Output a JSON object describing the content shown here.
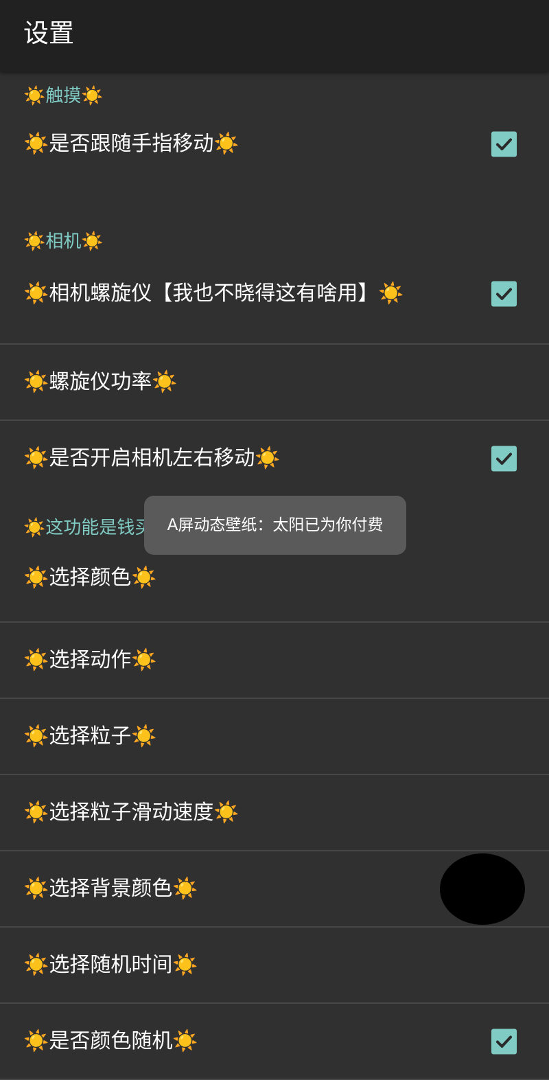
{
  "app_bar": {
    "title": "设置"
  },
  "preferences": {
    "touch_category": "☀️触摸☀️",
    "follow_finger": {
      "title": "☀️是否跟随手指移动☀️",
      "checked": true
    },
    "camera_category": "☀️相机☀️",
    "camera_gyro": {
      "title": "☀️相机螺旋仪【我也不晓得这有啥用】☀️",
      "checked": true
    },
    "gyro_power": {
      "title": "☀️螺旋仪功率☀️"
    },
    "camera_lr_move": {
      "title": "☀️是否开启相机左右移动☀️",
      "checked": true
    },
    "paid_category": "☀️这功能是钱买的☀️",
    "select_color": {
      "title": "☀️选择颜色☀️"
    },
    "select_action": {
      "title": "☀️选择动作☀️"
    },
    "select_particle": {
      "title": "☀️选择粒子☀️"
    },
    "particle_speed": {
      "title": "☀️选择粒子滑动速度☀️"
    },
    "background_color": {
      "title": "☀️选择背景颜色☀️",
      "swatch_color": "#000000"
    },
    "random_time": {
      "title": "☀️选择随机时间☀️"
    },
    "random_color": {
      "title": "☀️是否颜色随机☀️",
      "checked": true
    }
  },
  "toast": {
    "text": "A屏动态壁纸：太阳已为你付费"
  },
  "colors": {
    "accent": "#80cbc4",
    "background": "#303030",
    "app_bar": "#212121",
    "divider": "#474747",
    "toast": "#5a5a5a"
  }
}
